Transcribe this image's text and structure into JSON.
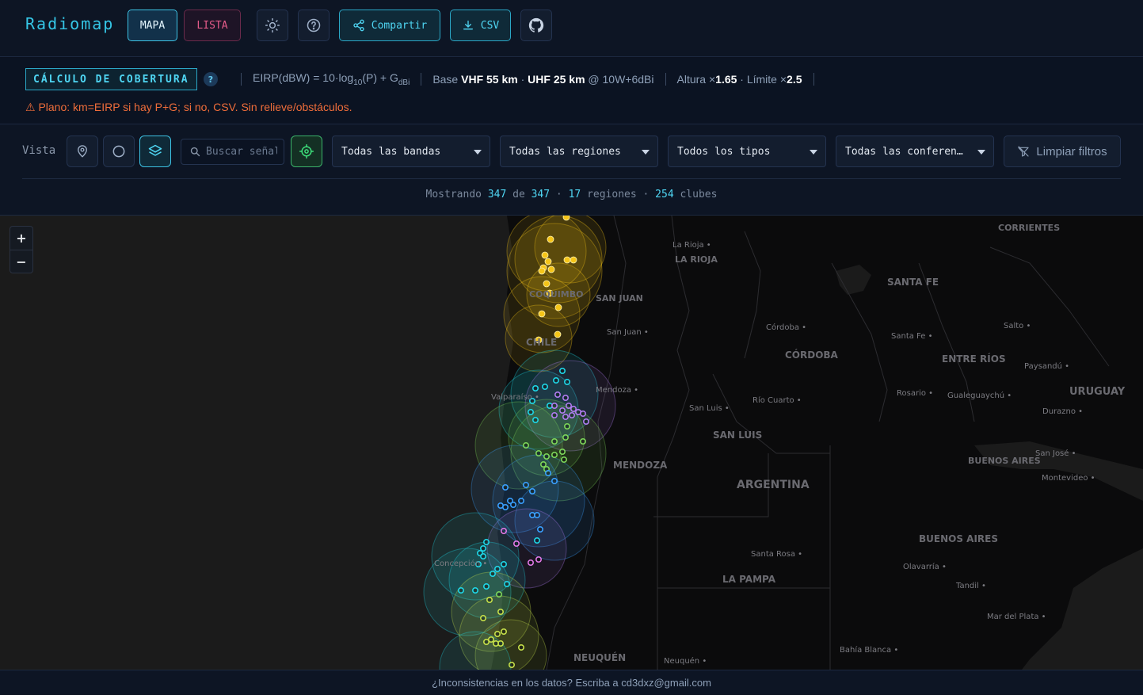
{
  "header": {
    "brand": "Radiomap",
    "tab_map": "MAPA",
    "tab_list": "LISTA",
    "share_label": "Compartir",
    "csv_label": "CSV"
  },
  "info": {
    "badge": "CÁLCULO DE COBERTURA",
    "help": "?",
    "formula_prefix": "EIRP(dBW) = 10·log",
    "formula_sub1": "10",
    "formula_mid": "(P) + G",
    "formula_sub2": "dBi",
    "base_label": "Base",
    "base_vhf": "VHF 55 km",
    "base_dot": "·",
    "base_uhf": "UHF 25 km",
    "base_suffix": "@ 10W+6dBi",
    "height_label": "Altura ×",
    "height_value": "1.65",
    "limit_label": "· Límite ×",
    "limit_value": "2.5",
    "warning": "⚠ Plano: km=EIRP si hay P+G; si no, CSV. Sin relieve/obstáculos."
  },
  "filters": {
    "vista_label": "Vista",
    "search_placeholder": "Buscar señal",
    "bands": "Todas las bandas",
    "regions": "Todas las regiones",
    "types": "Todos los tipos",
    "conferences": "Todas las conferencias",
    "clear_label": "Limpiar filtros"
  },
  "stats": {
    "prefix": "Mostrando",
    "shown": "347",
    "of": "de",
    "total": "347",
    "dot1": "·",
    "regions": "17",
    "regions_label": "regiones",
    "dot2": "·",
    "clubs": "254",
    "clubs_label": "clubes"
  },
  "map": {
    "zoom_in": "+",
    "zoom_out": "−",
    "labels": [
      {
        "id": "corrientes",
        "text": "CORRIENTES"
      },
      {
        "id": "la-rioja-city",
        "text": "La Rioja"
      },
      {
        "id": "la-rioja",
        "text": "LA RIOJA"
      },
      {
        "id": "santa-fe",
        "text": "SANTA FE"
      },
      {
        "id": "san-juan",
        "text": "SAN JUAN"
      },
      {
        "id": "coquimbo",
        "text": "COQUIMBO"
      },
      {
        "id": "san-juan-city",
        "text": "San Juan"
      },
      {
        "id": "cordoba-city",
        "text": "Córdoba"
      },
      {
        "id": "santa-fe-city",
        "text": "Santa Fe"
      },
      {
        "id": "salto",
        "text": "Salto"
      },
      {
        "id": "chile",
        "text": "CHILE"
      },
      {
        "id": "cordoba",
        "text": "CÓRDOBA"
      },
      {
        "id": "entre-rios",
        "text": "ENTRE RÍOS"
      },
      {
        "id": "paysandu",
        "text": "Paysandú"
      },
      {
        "id": "mendoza-city",
        "text": "Mendoza"
      },
      {
        "id": "valparaiso",
        "text": "Valparaíso"
      },
      {
        "id": "rosario",
        "text": "Rosario"
      },
      {
        "id": "gualeguaychu",
        "text": "Gualeguaychú"
      },
      {
        "id": "uruguay",
        "text": "URUGUAY"
      },
      {
        "id": "rio-cuarto",
        "text": "Río Cuarto"
      },
      {
        "id": "san-luis-city",
        "text": "San Luis"
      },
      {
        "id": "durazno",
        "text": "Durazno"
      },
      {
        "id": "san-luis",
        "text": "SAN LUIS"
      },
      {
        "id": "buenos-aires-city",
        "text": "BUENOS AIRES"
      },
      {
        "id": "san-jose",
        "text": "San José"
      },
      {
        "id": "mendoza",
        "text": "MENDOZA"
      },
      {
        "id": "argentina",
        "text": "ARGENTINA"
      },
      {
        "id": "montevideo",
        "text": "Montevideo"
      },
      {
        "id": "buenos-aires",
        "text": "BUENOS AIRES"
      },
      {
        "id": "santa-rosa",
        "text": "Santa Rosa"
      },
      {
        "id": "la-pampa",
        "text": "LA PAMPA"
      },
      {
        "id": "olavarria",
        "text": "Olavarría"
      },
      {
        "id": "concepcion",
        "text": "Concepción"
      },
      {
        "id": "tandil",
        "text": "Tandil"
      },
      {
        "id": "mar-del-plata",
        "text": "Mar del Plata"
      },
      {
        "id": "bahia-blanca",
        "text": "Bahía Blanca"
      },
      {
        "id": "neuquen",
        "text": "NEUQUÉN"
      },
      {
        "id": "neuquen-city",
        "text": "Neuquén"
      }
    ]
  },
  "footer": {
    "text": "¿Inconsistencias en los datos? Escriba a cd3dxz@gmail.com"
  }
}
